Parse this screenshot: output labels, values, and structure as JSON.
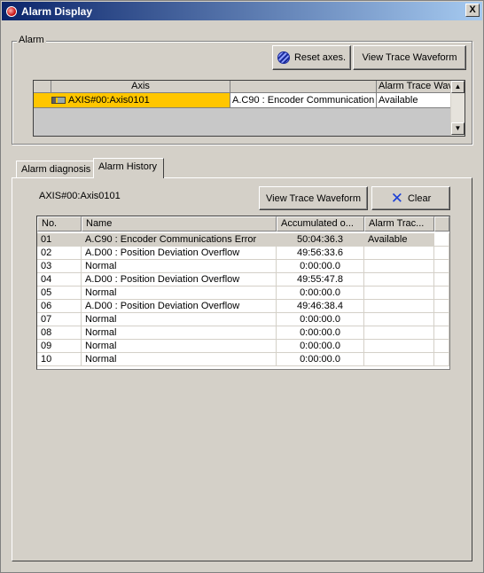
{
  "window": {
    "title": "Alarm Display",
    "close_glyph": "X"
  },
  "alarm_group": {
    "legend": "Alarm",
    "reset_axes_label": "Reset axes.",
    "view_trace_label": "View Trace Waveform",
    "columns": [
      "Axis",
      "",
      "Alarm Trace Wav"
    ],
    "row": {
      "axis": "AXIS#00:Axis0101",
      "alarm": "A.C90 : Encoder Communication",
      "trace": "Available"
    },
    "highlight_color": "#ffc600"
  },
  "tabs": [
    {
      "label": "Alarm diagnosis",
      "active": false
    },
    {
      "label": "Alarm History",
      "active": true
    }
  ],
  "history": {
    "axis_label": "AXIS#00:Axis0101",
    "view_trace_label": "View Trace Waveform",
    "clear_label": "Clear",
    "columns": [
      "No.",
      "Name",
      "Accumulated o...",
      "Alarm Trac...",
      ""
    ],
    "rows": [
      {
        "no": "01",
        "name": "A.C90 : Encoder Communications Error",
        "time": "50:04:36.3",
        "trace": "Available"
      },
      {
        "no": "02",
        "name": "A.D00 : Position Deviation Overflow",
        "time": "49:56:33.6",
        "trace": ""
      },
      {
        "no": "03",
        "name": "Normal",
        "time": "0:00:00.0",
        "trace": ""
      },
      {
        "no": "04",
        "name": "A.D00 : Position Deviation Overflow",
        "time": "49:55:47.8",
        "trace": ""
      },
      {
        "no": "05",
        "name": "Normal",
        "time": "0:00:00.0",
        "trace": ""
      },
      {
        "no": "06",
        "name": "A.D00 : Position Deviation Overflow",
        "time": "49:46:38.4",
        "trace": ""
      },
      {
        "no": "07",
        "name": "Normal",
        "time": "0:00:00.0",
        "trace": ""
      },
      {
        "no": "08",
        "name": "Normal",
        "time": "0:00:00.0",
        "trace": ""
      },
      {
        "no": "09",
        "name": "Normal",
        "time": "0:00:00.0",
        "trace": ""
      },
      {
        "no": "10",
        "name": "Normal",
        "time": "0:00:00.0",
        "trace": ""
      }
    ]
  }
}
